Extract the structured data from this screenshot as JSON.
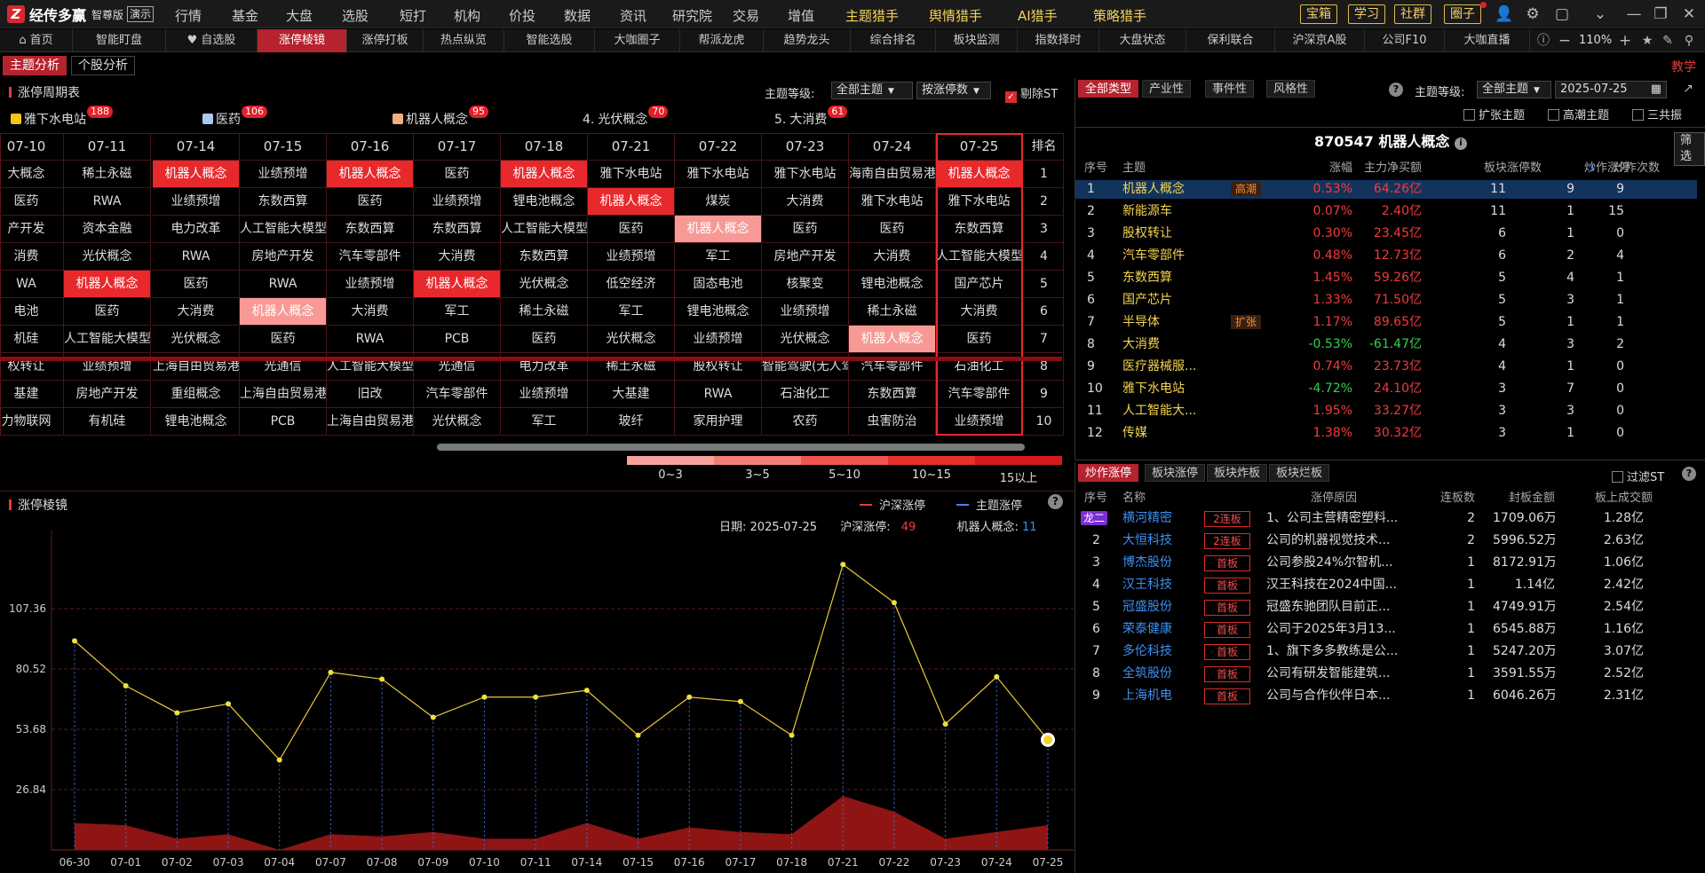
{
  "app": {
    "logo_letter": "Z",
    "name": "经传多赢",
    "edition": "智尊版",
    "demo": "演示"
  },
  "top_menu": [
    {
      "label": "行情",
      "color": "n"
    },
    {
      "label": "基金",
      "color": "n"
    },
    {
      "label": "大盘",
      "color": "n"
    },
    {
      "label": "选股",
      "color": "n"
    },
    {
      "label": "短打",
      "color": "n"
    },
    {
      "label": "机构",
      "color": "n"
    },
    {
      "label": "价投",
      "color": "n"
    },
    {
      "label": "数据",
      "color": "n"
    },
    {
      "label": "资讯",
      "color": "n"
    },
    {
      "label": "研究院",
      "color": "n"
    },
    {
      "label": "交易",
      "color": "n"
    },
    {
      "label": "增值",
      "color": "n"
    },
    {
      "label": "主题猎手",
      "color": "y"
    },
    {
      "label": "舆情猎手",
      "color": "y"
    },
    {
      "label": "AI猎手",
      "color": "y"
    },
    {
      "label": "策略猎手",
      "color": "y"
    }
  ],
  "right_buttons": [
    "宝箱",
    "学习",
    "社群",
    "圈子"
  ],
  "nav_tabs": [
    "首页",
    "智能盯盘",
    "自选股",
    "涨停棱镜",
    "涨停打板",
    "热点纵览",
    "智能选股",
    "大咖圈子",
    "帮派龙虎",
    "趋势龙头",
    "综合排名",
    "板块监测",
    "指数择时",
    "大盘状态",
    "保利联合",
    "沪深京A股",
    "公司F10",
    "大咖直播"
  ],
  "nav_active": 3,
  "zoom": "110%",
  "sub_tabs": [
    "主题分析",
    "个股分析"
  ],
  "help": "教学",
  "cycle": {
    "title": "涨停周期表",
    "theme_level_label": "主题等级:",
    "theme_level_value": "全部主题",
    "sort_value": "按涨停数",
    "remove_st": "剔除ST",
    "top_tags": [
      {
        "rank": "",
        "name": "雅下水电站",
        "count": "188",
        "color": "#f5c518"
      },
      {
        "rank": "",
        "name": "医药",
        "count": "106",
        "color": "#aac8f0"
      },
      {
        "rank": "",
        "name": "机器人概念",
        "count": "95",
        "color": "#f0b080"
      },
      {
        "rank": "4.",
        "name": "光伏概念",
        "count": "70",
        "color": ""
      },
      {
        "rank": "5.",
        "name": "大消费",
        "count": "61",
        "color": ""
      }
    ],
    "dates": [
      "07-10",
      "07-11",
      "07-14",
      "07-15",
      "07-16",
      "07-17",
      "07-18",
      "07-21",
      "07-22",
      "07-23",
      "07-24",
      "07-25"
    ],
    "rank_header": "排名",
    "ranks": [
      "1",
      "2",
      "3",
      "4",
      "5",
      "6",
      "7",
      "8",
      "9",
      "10"
    ],
    "rows": [
      [
        "大概念",
        "稀土永磁",
        "机器人概念",
        "业绩预增",
        "机器人概念",
        "医药",
        "机器人概念",
        "雅下水电站",
        "雅下水电站",
        "雅下水电站",
        "海南自由贸易港",
        "机器人概念"
      ],
      [
        "医药",
        "RWA",
        "业绩预增",
        "东数西算",
        "医药",
        "业绩预增",
        "锂电池概念",
        "机器人概念",
        "煤炭",
        "大消费",
        "雅下水电站",
        "雅下水电站"
      ],
      [
        "产开发",
        "资本金融",
        "电力改革",
        "人工智能大模型",
        "东数西算",
        "东数西算",
        "人工智能大模型",
        "医药",
        "机器人概念",
        "医药",
        "医药",
        "东数西算"
      ],
      [
        "消费",
        "光伏概念",
        "RWA",
        "房地产开发",
        "汽车零部件",
        "大消费",
        "东数西算",
        "业绩预增",
        "军工",
        "房地产开发",
        "大消费",
        "人工智能大模型"
      ],
      [
        "WA",
        "机器人概念",
        "医药",
        "RWA",
        "业绩预增",
        "机器人概念",
        "光伏概念",
        "低空经济",
        "固态电池",
        "核聚变",
        "锂电池概念",
        "国产芯片"
      ],
      [
        "电池",
        "医药",
        "大消费",
        "机器人概念",
        "大消费",
        "军工",
        "稀土永磁",
        "军工",
        "锂电池概念",
        "业绩预增",
        "稀土永磁",
        "大消费"
      ],
      [
        "机硅",
        "人工智能大模型",
        "光伏概念",
        "医药",
        "RWA",
        "PCB",
        "医药",
        "光伏概念",
        "业绩预增",
        "光伏概念",
        "机器人概念",
        "医药"
      ],
      [
        "权转让",
        "业绩预增",
        "上海自由贸易港",
        "光通信",
        "人工智能大模型",
        "光通信",
        "电力改革",
        "稀土永磁",
        "股权转让",
        "智能驾驶(无人驾驶)",
        "汽车零部件",
        "石油化工"
      ],
      [
        "基建",
        "房地产开发",
        "重组概念",
        "上海自由贸易港",
        "旧改",
        "汽车零部件",
        "业绩预增",
        "大基建",
        "RWA",
        "石油化工",
        "东数西算",
        "汽车零部件"
      ],
      [
        "力物联网",
        "有机硅",
        "锂电池概念",
        "PCB",
        "上海自由贸易港",
        "光伏概念",
        "军工",
        "玻纤",
        "家用护理",
        "农药",
        "虫害防治",
        "业绩预增"
      ]
    ],
    "heat": [
      [
        0,
        0,
        1,
        0,
        1,
        0,
        1,
        0,
        0,
        0,
        0,
        1
      ],
      [
        0,
        0,
        0,
        0,
        0,
        0,
        0,
        1,
        0,
        0,
        0,
        0
      ],
      [
        0,
        0,
        0,
        0,
        0,
        0,
        0,
        0,
        3,
        0,
        0,
        0
      ],
      [
        0,
        0,
        0,
        0,
        0,
        0,
        0,
        0,
        0,
        0,
        0,
        0
      ],
      [
        0,
        1,
        0,
        0,
        0,
        1,
        0,
        0,
        0,
        0,
        0,
        0
      ],
      [
        0,
        0,
        0,
        3,
        0,
        0,
        0,
        0,
        0,
        0,
        0,
        0
      ],
      [
        0,
        0,
        0,
        0,
        0,
        0,
        0,
        0,
        0,
        0,
        3,
        0
      ],
      [
        0,
        0,
        0,
        0,
        0,
        0,
        0,
        0,
        0,
        0,
        0,
        0
      ],
      [
        0,
        0,
        0,
        0,
        0,
        0,
        0,
        0,
        0,
        0,
        0,
        0
      ],
      [
        0,
        0,
        0,
        0,
        0,
        0,
        0,
        0,
        0,
        0,
        0,
        0
      ]
    ],
    "legend": [
      {
        "label": "0~3",
        "color": "#f7a19c"
      },
      {
        "label": "3~5",
        "color": "#f37d77"
      },
      {
        "label": "5~10",
        "color": "#ee5450"
      },
      {
        "label": "10~15",
        "color": "#e8302c"
      },
      {
        "label": "15以上",
        "color": "#d41a1a"
      }
    ]
  },
  "prism": {
    "title": "涨停棱镜",
    "legend_a": "沪深涨停",
    "legend_b": "主题涨停",
    "date_label": "日期:",
    "date_value": "2025-07-25",
    "hs_label": "沪深涨停:",
    "hs_value": "49",
    "theme_label": "机器人概念:",
    "theme_value": "11",
    "y_ticks": [
      "107.36",
      "80.52",
      "53.68",
      "26.84"
    ]
  },
  "chart_data": {
    "type": "line",
    "title": "",
    "x": [
      "06-30",
      "07-01",
      "07-02",
      "07-03",
      "07-04",
      "07-07",
      "07-08",
      "07-09",
      "07-10",
      "07-11",
      "07-14",
      "07-15",
      "07-16",
      "07-17",
      "07-18",
      "07-21",
      "07-22",
      "07-23",
      "07-24",
      "07-25"
    ],
    "series": [
      {
        "name": "沪深涨停",
        "values": [
          93,
          73,
          61,
          65,
          40,
          79,
          76,
          59,
          68,
          68,
          71,
          51,
          68,
          66,
          51,
          127,
          110,
          56,
          77,
          49
        ]
      },
      {
        "name": "主题涨停",
        "values": [
          12,
          11,
          5,
          7,
          0,
          7,
          6,
          8,
          5,
          5,
          12,
          5,
          10,
          8,
          7,
          24,
          17,
          5,
          8,
          11
        ]
      }
    ],
    "yticks": [
      107.36,
      80.52,
      53.68,
      26.84
    ],
    "ylim": [
      0,
      134.2
    ]
  },
  "right_top": {
    "tabs": [
      "全部类型",
      "产业性",
      "事件性",
      "风格性"
    ],
    "theme_level_label": "主题等级:",
    "theme_level_value": "全部主题",
    "date": "2025-07-25",
    "checks": [
      "扩张主题",
      "高潮主题",
      "三共振"
    ],
    "title": "870547 机器人概念",
    "filter_btn": "筛选",
    "headers": [
      "序号",
      "主题",
      "涨幅",
      "主力净买额",
      "板块涨停数",
      "炒作涨停",
      "炒作次数"
    ],
    "rows": [
      {
        "no": "1",
        "name": "机器人概念",
        "tag": "高潮",
        "chg": "0.53%",
        "net": "64.26亿",
        "lim": "11",
        "spec": "9",
        "times": "9",
        "up": true,
        "netup": true
      },
      {
        "no": "2",
        "name": "新能源车",
        "tag": "",
        "chg": "0.07%",
        "net": "2.40亿",
        "lim": "11",
        "spec": "1",
        "times": "15",
        "up": true,
        "netup": true
      },
      {
        "no": "3",
        "name": "股权转让",
        "tag": "",
        "chg": "0.30%",
        "net": "23.45亿",
        "lim": "6",
        "spec": "1",
        "times": "0",
        "up": true,
        "netup": true
      },
      {
        "no": "4",
        "name": "汽车零部件",
        "tag": "",
        "chg": "0.48%",
        "net": "12.73亿",
        "lim": "6",
        "spec": "2",
        "times": "4",
        "up": true,
        "netup": true
      },
      {
        "no": "5",
        "name": "东数西算",
        "tag": "",
        "chg": "1.45%",
        "net": "59.26亿",
        "lim": "5",
        "spec": "4",
        "times": "1",
        "up": true,
        "netup": true
      },
      {
        "no": "6",
        "name": "国产芯片",
        "tag": "",
        "chg": "1.33%",
        "net": "71.50亿",
        "lim": "5",
        "spec": "3",
        "times": "1",
        "up": true,
        "netup": true
      },
      {
        "no": "7",
        "name": "半导体",
        "tag": "扩张",
        "chg": "1.17%",
        "net": "89.65亿",
        "lim": "5",
        "spec": "1",
        "times": "1",
        "up": true,
        "netup": true
      },
      {
        "no": "8",
        "name": "大消费",
        "tag": "",
        "chg": "-0.53%",
        "net": "-61.47亿",
        "lim": "4",
        "spec": "3",
        "times": "2",
        "up": false,
        "netup": false
      },
      {
        "no": "9",
        "name": "医疗器械服...",
        "tag": "",
        "chg": "0.74%",
        "net": "23.73亿",
        "lim": "4",
        "spec": "1",
        "times": "0",
        "up": true,
        "netup": true
      },
      {
        "no": "10",
        "name": "雅下水电站",
        "tag": "",
        "chg": "-4.72%",
        "net": "24.10亿",
        "lim": "3",
        "spec": "7",
        "times": "0",
        "up": false,
        "netup": true
      },
      {
        "no": "11",
        "name": "人工智能大...",
        "tag": "",
        "chg": "1.95%",
        "net": "33.27亿",
        "lim": "3",
        "spec": "3",
        "times": "0",
        "up": true,
        "netup": true
      },
      {
        "no": "12",
        "name": "传媒",
        "tag": "",
        "chg": "1.38%",
        "net": "30.32亿",
        "lim": "3",
        "spec": "1",
        "times": "0",
        "up": true,
        "netup": true
      }
    ]
  },
  "right_bottom": {
    "tabs": [
      "炒作涨停",
      "板块涨停",
      "板块炸板",
      "板块烂板"
    ],
    "filter_st": "过滤ST",
    "headers": [
      "序号",
      "名称",
      "涨停原因",
      "连板数",
      "封板金额",
      "板上成交额"
    ],
    "rows": [
      {
        "no": "龙二",
        "name": "横河精密",
        "badge": "2连板",
        "reason": "1、公司主营精密塑料...",
        "boards": "2",
        "seal": "1709.06万",
        "vol": "1.28亿"
      },
      {
        "no": "2",
        "name": "大恒科技",
        "badge": "2连板",
        "reason": "公司的机器视觉技术...",
        "boards": "2",
        "seal": "5996.52万",
        "vol": "2.63亿"
      },
      {
        "no": "3",
        "name": "博杰股份",
        "badge": "首板",
        "reason": "公司参股24%尔智机...",
        "boards": "1",
        "seal": "8172.91万",
        "vol": "1.06亿"
      },
      {
        "no": "4",
        "name": "汉王科技",
        "badge": "首板",
        "reason": "汉王科技在2024中国...",
        "boards": "1",
        "seal": "1.14亿",
        "vol": "2.42亿"
      },
      {
        "no": "5",
        "name": "冠盛股份",
        "badge": "首板",
        "reason": "冠盛东驰团队目前正...",
        "boards": "1",
        "seal": "4749.91万",
        "vol": "2.54亿"
      },
      {
        "no": "6",
        "name": "荣泰健康",
        "badge": "首板",
        "reason": "公司于2025年3月13...",
        "boards": "1",
        "seal": "6545.88万",
        "vol": "1.16亿"
      },
      {
        "no": "7",
        "name": "多伦科技",
        "badge": "首板",
        "reason": "1、旗下多多教练是公...",
        "boards": "1",
        "seal": "5247.20万",
        "vol": "3.07亿"
      },
      {
        "no": "8",
        "name": "全筑股份",
        "badge": "首板",
        "reason": "公司有研发智能建筑...",
        "boards": "1",
        "seal": "3591.55万",
        "vol": "2.52亿"
      },
      {
        "no": "9",
        "name": "上海机电",
        "badge": "首板",
        "reason": "公司与合作伙伴日本...",
        "boards": "1",
        "seal": "6046.26万",
        "vol": "2.31亿"
      }
    ]
  }
}
